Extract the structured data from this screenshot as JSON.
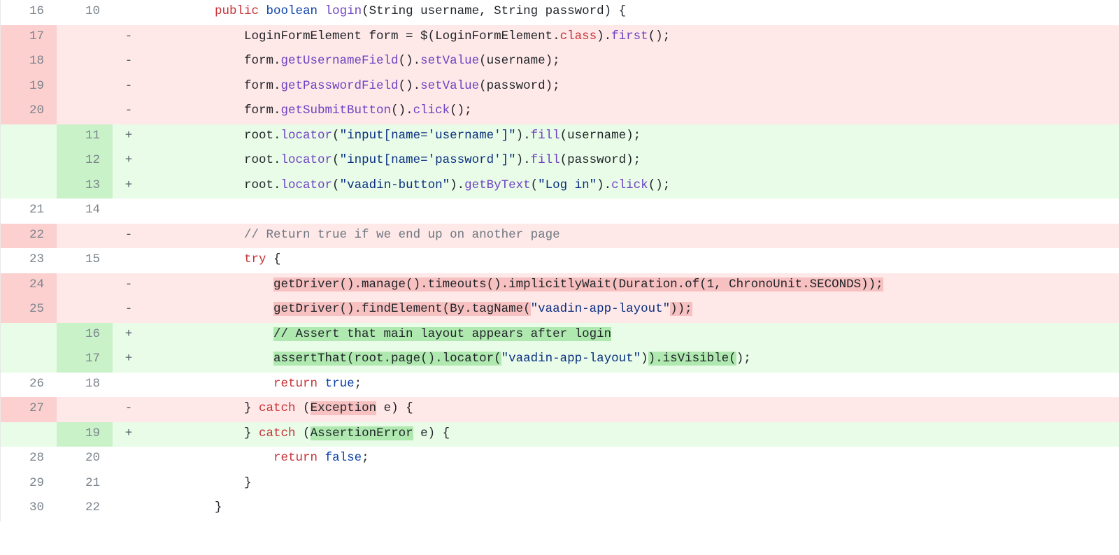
{
  "rows": [
    {
      "type": "ctx",
      "oldNum": "16",
      "newNum": "10",
      "marker": "",
      "html": "        <span class='kw'>public</span> <span class='kwblue'>boolean</span> <span class='fn'>login</span>(String username, String password) {"
    },
    {
      "type": "del",
      "oldNum": "17",
      "newNum": "",
      "marker": "-",
      "html": "            LoginFormElement form = $(LoginFormElement.<span class='kw'>class</span>).<span class='fn'>first</span>();"
    },
    {
      "type": "del",
      "oldNum": "18",
      "newNum": "",
      "marker": "-",
      "html": "            form.<span class='fn'>getUsernameField</span>().<span class='fn'>setValue</span>(username);"
    },
    {
      "type": "del",
      "oldNum": "19",
      "newNum": "",
      "marker": "-",
      "html": "            form.<span class='fn'>getPasswordField</span>().<span class='fn'>setValue</span>(password);"
    },
    {
      "type": "del",
      "oldNum": "20",
      "newNum": "",
      "marker": "-",
      "html": "            form.<span class='fn'>getSubmitButton</span>().<span class='fn'>click</span>();"
    },
    {
      "type": "add",
      "oldNum": "",
      "newNum": "11",
      "marker": "+",
      "html": "            root.<span class='fn'>locator</span>(<span class='str'>\"input[name='username']\"</span>).<span class='fn'>fill</span>(username);"
    },
    {
      "type": "add",
      "oldNum": "",
      "newNum": "12",
      "marker": "+",
      "html": "            root.<span class='fn'>locator</span>(<span class='str'>\"input[name='password']\"</span>).<span class='fn'>fill</span>(password);"
    },
    {
      "type": "add",
      "oldNum": "",
      "newNum": "13",
      "marker": "+",
      "html": "            root.<span class='fn'>locator</span>(<span class='str'>\"vaadin-button\"</span>).<span class='fn'>getByText</span>(<span class='str'>\"Log in\"</span>).<span class='fn'>click</span>();"
    },
    {
      "type": "ctx",
      "oldNum": "21",
      "newNum": "14",
      "marker": "",
      "html": ""
    },
    {
      "type": "del",
      "oldNum": "22",
      "newNum": "",
      "marker": "-",
      "html": "            <span class='cmt'>// Return true if we end up on another page</span>"
    },
    {
      "type": "ctx",
      "oldNum": "23",
      "newNum": "15",
      "marker": "",
      "html": "            <span class='kw'>try</span> {"
    },
    {
      "type": "del",
      "oldNum": "24",
      "newNum": "",
      "marker": "-",
      "html": "                <span class='hl-del'>getDriver().manage().timeouts().implicitlyWait(Duration.of(1, ChronoUnit.SECONDS));</span>"
    },
    {
      "type": "del",
      "oldNum": "25",
      "newNum": "",
      "marker": "-",
      "html": "                <span class='hl-del'>getDriver().findElement(By.tagName(</span><span class='str'>\"vaadin-app-layout\"</span><span class='hl-del'>));</span>"
    },
    {
      "type": "add",
      "oldNum": "",
      "newNum": "16",
      "marker": "+",
      "html": "                <span class='hl-add'>// Assert that main layout appears after login</span>"
    },
    {
      "type": "add",
      "oldNum": "",
      "newNum": "17",
      "marker": "+",
      "html": "                <span class='hl-add'>assertThat(root.page().locator(</span><span class='str'>\"vaadin-app-layout\"</span>)<span class='hl-add'>).isVisible(</span>);"
    },
    {
      "type": "ctx",
      "oldNum": "26",
      "newNum": "18",
      "marker": "",
      "html": "                <span class='kw'>return</span> <span class='kwblue'>true</span>;"
    },
    {
      "type": "del",
      "oldNum": "27",
      "newNum": "",
      "marker": "-",
      "html": "            } <span class='kw'>catch</span> (<span class='hl-del'>Exception</span> e) {"
    },
    {
      "type": "add",
      "oldNum": "",
      "newNum": "19",
      "marker": "+",
      "html": "            } <span class='kw'>catch</span> (<span class='hl-add'>AssertionError</span> e) {"
    },
    {
      "type": "ctx",
      "oldNum": "28",
      "newNum": "20",
      "marker": "",
      "html": "                <span class='kw'>return</span> <span class='kwblue'>false</span>;"
    },
    {
      "type": "ctx",
      "oldNum": "29",
      "newNum": "21",
      "marker": "",
      "html": "            }"
    },
    {
      "type": "ctx",
      "oldNum": "30",
      "newNum": "22",
      "marker": "",
      "html": "        }"
    }
  ]
}
